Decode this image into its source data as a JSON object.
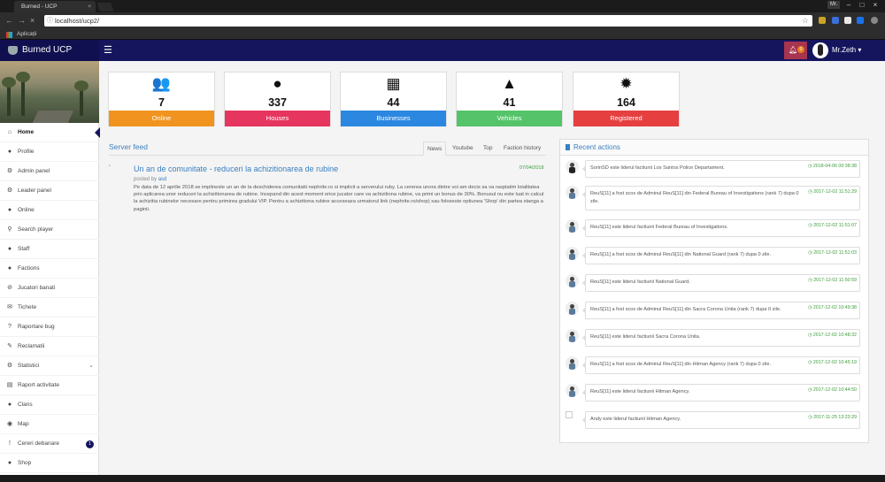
{
  "browser": {
    "tab_title": "Burned - UCP",
    "tab_close": "×",
    "url": "localhost/ucp2/",
    "user": "Mr.",
    "bookmark_label": "Aplicații",
    "icons": {
      "back": "arrow-left-icon",
      "forward": "arrow-right-icon",
      "reload": "close-icon",
      "info": "info-icon",
      "star": "star-icon"
    }
  },
  "header": {
    "brand": "Burned UCP",
    "menu_glyph": "☰",
    "notif_count": "0",
    "username": "Mr.Zeth",
    "caret": "▾"
  },
  "sidebar": {
    "items": [
      {
        "label": "Home",
        "icon": "⌂"
      },
      {
        "label": "Profile",
        "icon": "●"
      },
      {
        "label": "Admin panel",
        "icon": "⚙"
      },
      {
        "label": "Leader panel",
        "icon": "⚙"
      },
      {
        "label": "Online",
        "icon": "●"
      },
      {
        "label": "Search player",
        "icon": "⚲"
      },
      {
        "label": "Staff",
        "icon": "●"
      },
      {
        "label": "Factions",
        "icon": "●"
      },
      {
        "label": "Jucatori banati",
        "icon": "⊘"
      },
      {
        "label": "Tichete",
        "icon": "✉"
      },
      {
        "label": "Raportare bug",
        "icon": "?"
      },
      {
        "label": "Reclamatii",
        "icon": "✎"
      },
      {
        "label": "Statistici",
        "icon": "⚙"
      },
      {
        "label": "Raport activitate",
        "icon": "▤"
      },
      {
        "label": "Clans",
        "icon": "●"
      },
      {
        "label": "Map",
        "icon": "◉"
      },
      {
        "label": "Cereri debanare",
        "icon": "!"
      },
      {
        "label": "Shop",
        "icon": "●"
      }
    ],
    "statistici_chevron": "⌄",
    "cereri_badge": "1"
  },
  "stats": [
    {
      "icon": "users-icon",
      "glyph": "👥",
      "value": "7",
      "label": "Online",
      "color": "#f0941f"
    },
    {
      "icon": "user-icon",
      "glyph": "●",
      "value": "337",
      "label": "Houses",
      "color": "#e6355e"
    },
    {
      "icon": "building-icon",
      "glyph": "▦",
      "value": "44",
      "label": "Businesses",
      "color": "#2b87e0"
    },
    {
      "icon": "road-icon",
      "glyph": "▲",
      "value": "41",
      "label": "Vehicles",
      "color": "#55c36a"
    },
    {
      "icon": "badge-icon",
      "glyph": "✹",
      "value": "164",
      "label": "Registered",
      "color": "#e63f3f"
    }
  ],
  "feed": {
    "title": "Server feed",
    "tabs": [
      "News",
      "Youtube",
      "Top",
      "Faction history"
    ],
    "post": {
      "title": "Un an de comunitate - reduceri la achizitionarea de rubine",
      "date": "07/04/2018",
      "posted_by_label": "posted by",
      "author": "asd",
      "body": "Pe data de 12 aprilie 2018 se implineste un an de la deschiderea comunitatii nephrite.ro si implicit a serverului ruby. La cererea unora dintre voi am decis sa va rasplatim loialitatea prin aplicarea unor reduceri la achizitionarea de rubine. Incepand din acest moment orice jucator care va achizitiona rubine, va primi un bonus de 30%. Bonusul nu este luat in calcul la achizitia rubinelor necesare pentru primirea gradului VIP. Pentru a achizitiona rubine acceseaza urmatorul link (nephrite.ro/shop) sau foloseste optiunea 'Shop' din partea stanga a paginii."
    }
  },
  "recent": {
    "title": "Recent actions",
    "items": [
      {
        "text": "SorinSD este liderul factiunii Los Santos Police Departament.",
        "time": "2018-04-06 00:38:38",
        "avatar": "dark"
      },
      {
        "text": "ReuS[11] a fost scos de Adminul ReuS[11] din Federal Bureau of Investigations (rank 7) dupa 0 zile.",
        "time": "2017-12-02 11:51:29",
        "avatar": "user"
      },
      {
        "text": "ReuS[11] este liderul factiunii Federal Bureau of Investigations.",
        "time": "2017-12-02 11:51:07",
        "avatar": "user"
      },
      {
        "text": "ReuS[11] a fost scos de Adminul ReuS[11] din National Guard (rank 7) dupa 0 zile.",
        "time": "2017-12-02 11:51:03",
        "avatar": "user"
      },
      {
        "text": "ReuS[11] este liderul factiunii National Guard.",
        "time": "2017-12-02 11:50:59",
        "avatar": "user"
      },
      {
        "text": "ReuS[11] a fost scos de Adminul ReuS[11] din Sacra Corona Unita (rank 7) dupa 0 zile.",
        "time": "2017-12-02 10:49:38",
        "avatar": "user"
      },
      {
        "text": "ReuS[11] este liderul factiunii Sacra Corona Unita.",
        "time": "2017-12-02 10:48:32",
        "avatar": "user"
      },
      {
        "text": "ReuS[11] a fost scos de Adminul ReuS[11] din Hitman Agency (rank 7) dupa 0 zile.",
        "time": "2017-12-02 10:45:19",
        "avatar": "user"
      },
      {
        "text": "ReuS[11] este liderul factiunii Hitman Agency.",
        "time": "2017-12-02 10:44:50",
        "avatar": "user"
      },
      {
        "text": "Andy este liderul factiunii Hitman Agency.",
        "time": "2017-11-25 13:23:29",
        "avatar": "broken"
      }
    ]
  }
}
